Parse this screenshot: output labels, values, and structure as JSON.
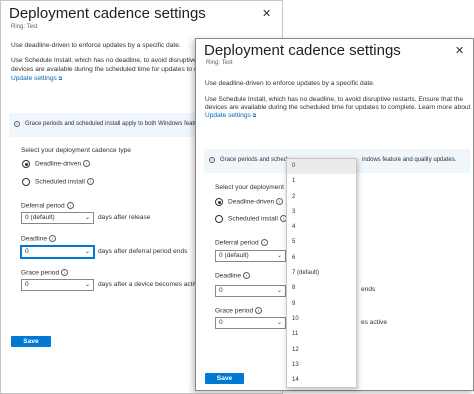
{
  "back": {
    "title": "Deployment cadence settings",
    "subtitle": "Ring: Test",
    "intro": "Use deadline-driven to enforce updates by a specific date.",
    "p1": "Use Schedule Install, which has no deadline, to avoid disruptive re",
    "p2": "devices are available during the scheduled time for updates to compl",
    "link": "Update settings",
    "banner": "Grace periods and scheduled install apply to both Windows featu",
    "cadence_label": "Select your deployment cadence type",
    "radio1": "Deadline-driven",
    "radio2": "Scheduled install",
    "deferral_label": "Deferral period",
    "deferral_value": "0 (default)",
    "deferral_suffix": "days after release",
    "deadline_label": "Deadline",
    "deadline_value": "0",
    "deadline_suffix": "days after deferral period ends",
    "grace_label": "Grace period",
    "grace_value": "0",
    "grace_suffix": "days after a device becomes active",
    "save": "Save"
  },
  "front": {
    "title": "Deployment cadence settings",
    "subtitle": "Ring: Test",
    "intro": "Use deadline-driven to enforce updates by a specific date.",
    "p1": "Use Schedule Install, which has no deadline, to avoid disruptive restarts. Ensure that the",
    "p2": "devices are available during the scheduled time for updates to complete. Learn more about",
    "link": "Update settings",
    "banner_a": "Grace periods and schedu",
    "banner_b": "indows feature and quality updates.",
    "cadence_label": "Select your deployment ca",
    "radio1": "Deadline-driven",
    "radio2": "Scheduled install",
    "deferral_label": "Deferral period",
    "deferral_value": "0 (default)",
    "deadline_label": "Deadline",
    "deadline_value": "0",
    "deadline_suffix": "ends",
    "grace_label": "Grace period",
    "grace_value": "0",
    "grace_suffix": "es active",
    "save": "Save"
  },
  "dropdown_options": [
    "0",
    "1",
    "2",
    "3",
    "4",
    "5",
    "6",
    "7 (default)",
    "8",
    "9",
    "10",
    "11",
    "12",
    "13",
    "14"
  ],
  "close_glyph": "✕",
  "ext_glyph": "⧉",
  "info_glyph": "i",
  "chevron_glyph": "⌄",
  "colors": {
    "accent": "#0078d4",
    "link": "#0067b8",
    "banner": "#eff6fc"
  }
}
